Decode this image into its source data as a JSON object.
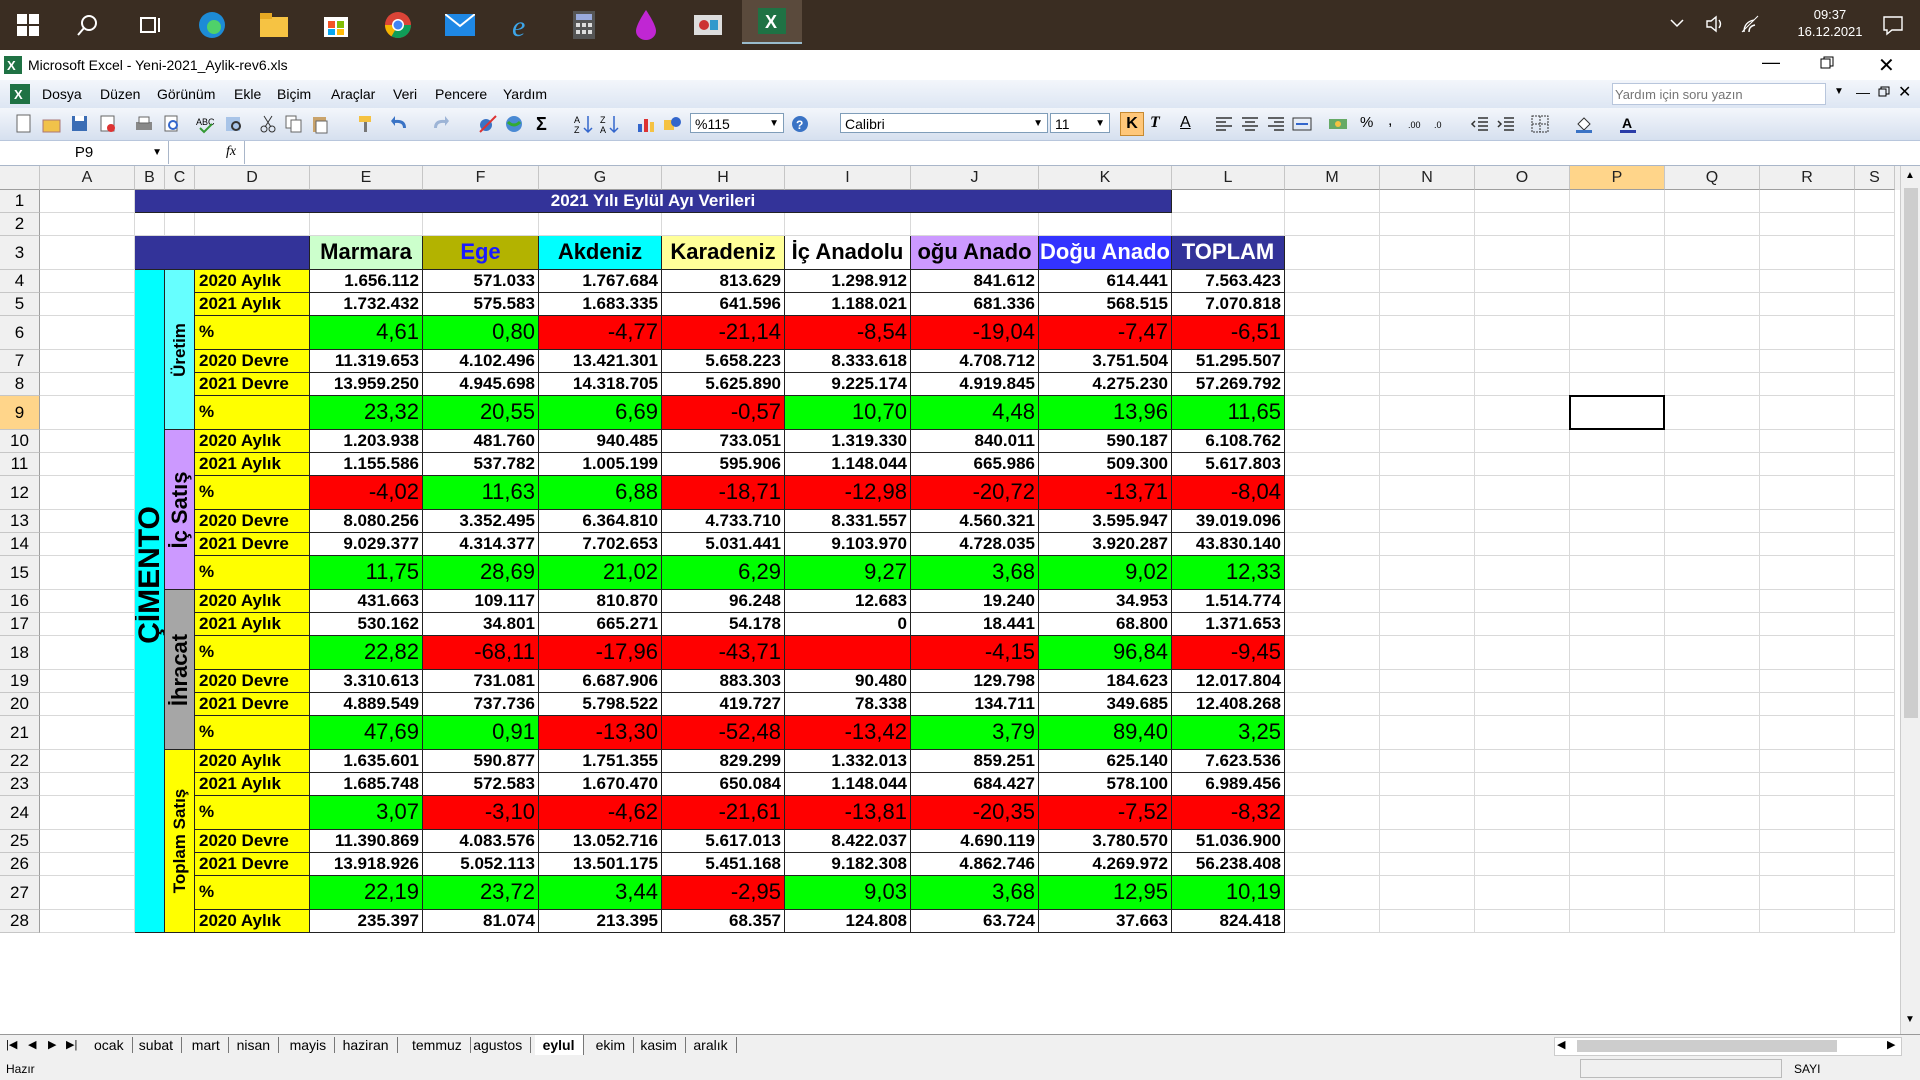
{
  "taskbar": {
    "time": "09:37",
    "date": "16.12.2021"
  },
  "window": {
    "title": "Microsoft Excel - Yeni-2021_Aylik-rev6.xls"
  },
  "menu": {
    "items": [
      "Dosya",
      "Düzen",
      "Görünüm",
      "Ekle",
      "Biçim",
      "Araçlar",
      "Veri",
      "Pencere",
      "Yardım"
    ],
    "help_placeholder": "Yardım için soru yazın"
  },
  "toolbar": {
    "zoom": "%115",
    "font": "Calibri",
    "size": "11"
  },
  "formula": {
    "name_box": "P9",
    "fx": "fx"
  },
  "columns": [
    "A",
    "B",
    "C",
    "D",
    "E",
    "F",
    "G",
    "H",
    "I",
    "J",
    "K",
    "L",
    "M",
    "N",
    "O",
    "P",
    "Q",
    "R",
    "S"
  ],
  "rows": [
    "1",
    "2",
    "3",
    "4",
    "5",
    "6",
    "7",
    "8",
    "9",
    "10",
    "11",
    "12",
    "13",
    "14",
    "15",
    "16",
    "17",
    "18",
    "19",
    "20",
    "21",
    "22",
    "23",
    "24",
    "25",
    "26",
    "27",
    "28"
  ],
  "sheet": {
    "title": "2021 Yılı Eylül Ayı Verileri",
    "headers": [
      "Marmara",
      "Ege",
      "Akdeniz",
      "Karadeniz",
      "İç Anadolu",
      "oğu Anado",
      "Doğu Anado",
      "TOPLAM"
    ],
    "header_colors": [
      "#ccffcc",
      "#b3b300",
      "#00ffff",
      "#ffff99",
      "#ffffff",
      "#cc99ff",
      "#3333ff",
      "#333399"
    ],
    "header_text_colors": [
      "#000000",
      "#1a1aff",
      "#000000",
      "#000000",
      "#000000",
      "#000000",
      "#ffffff",
      "#ffffff"
    ],
    "big_label": "ÇİMENTO",
    "groups": [
      {
        "label": "Üretim",
        "color": "#66ffff"
      },
      {
        "label": "İç Satış",
        "color": "#cc99ff"
      },
      {
        "label": "İhracat",
        "color": "#a6a6a6"
      },
      {
        "label": "Toplam Satış",
        "color": "#ffff00"
      }
    ],
    "data_rows": [
      {
        "label": "2020 Aylık",
        "pct": false,
        "values": [
          "1.656.112",
          "571.033",
          "1.767.684",
          "813.629",
          "1.298.912",
          "841.612",
          "614.441",
          "7.563.423"
        ]
      },
      {
        "label": "2021 Aylık",
        "pct": false,
        "values": [
          "1.732.432",
          "575.583",
          "1.683.335",
          "641.596",
          "1.188.021",
          "681.336",
          "568.515",
          "7.070.818"
        ]
      },
      {
        "label": "%",
        "pct": true,
        "values": [
          "4,61",
          "0,80",
          "-4,77",
          "-21,14",
          "-8,54",
          "-19,04",
          "-7,47",
          "-6,51"
        ]
      },
      {
        "label": "2020 Devre",
        "pct": false,
        "values": [
          "11.319.653",
          "4.102.496",
          "13.421.301",
          "5.658.223",
          "8.333.618",
          "4.708.712",
          "3.751.504",
          "51.295.507"
        ]
      },
      {
        "label": "2021 Devre",
        "pct": false,
        "values": [
          "13.959.250",
          "4.945.698",
          "14.318.705",
          "5.625.890",
          "9.225.174",
          "4.919.845",
          "4.275.230",
          "57.269.792"
        ]
      },
      {
        "label": "%",
        "pct": true,
        "values": [
          "23,32",
          "20,55",
          "6,69",
          "-0,57",
          "10,70",
          "4,48",
          "13,96",
          "11,65"
        ]
      },
      {
        "label": "2020 Aylık",
        "pct": false,
        "values": [
          "1.203.938",
          "481.760",
          "940.485",
          "733.051",
          "1.319.330",
          "840.011",
          "590.187",
          "6.108.762"
        ]
      },
      {
        "label": "2021 Aylık",
        "pct": false,
        "values": [
          "1.155.586",
          "537.782",
          "1.005.199",
          "595.906",
          "1.148.044",
          "665.986",
          "509.300",
          "5.617.803"
        ]
      },
      {
        "label": "%",
        "pct": true,
        "values": [
          "-4,02",
          "11,63",
          "6,88",
          "-18,71",
          "-12,98",
          "-20,72",
          "-13,71",
          "-8,04"
        ]
      },
      {
        "label": "2020 Devre",
        "pct": false,
        "values": [
          "8.080.256",
          "3.352.495",
          "6.364.810",
          "4.733.710",
          "8.331.557",
          "4.560.321",
          "3.595.947",
          "39.019.096"
        ]
      },
      {
        "label": "2021 Devre",
        "pct": false,
        "values": [
          "9.029.377",
          "4.314.377",
          "7.702.653",
          "5.031.441",
          "9.103.970",
          "4.728.035",
          "3.920.287",
          "43.830.140"
        ]
      },
      {
        "label": "%",
        "pct": true,
        "values": [
          "11,75",
          "28,69",
          "21,02",
          "6,29",
          "9,27",
          "3,68",
          "9,02",
          "12,33"
        ]
      },
      {
        "label": "2020 Aylık",
        "pct": false,
        "values": [
          "431.663",
          "109.117",
          "810.870",
          "96.248",
          "12.683",
          "19.240",
          "34.953",
          "1.514.774"
        ]
      },
      {
        "label": "2021 Aylık",
        "pct": false,
        "values": [
          "530.162",
          "34.801",
          "665.271",
          "54.178",
          "0",
          "18.441",
          "68.800",
          "1.371.653"
        ]
      },
      {
        "label": "%",
        "pct": true,
        "values": [
          "22,82",
          "-68,11",
          "-17,96",
          "-43,71",
          "",
          "-4,15",
          "96,84",
          "-9,45"
        ],
        "colors_override": [
          null,
          null,
          null,
          null,
          "#ff0000",
          null,
          null,
          null
        ]
      },
      {
        "label": "2020 Devre",
        "pct": false,
        "values": [
          "3.310.613",
          "731.081",
          "6.687.906",
          "883.303",
          "90.480",
          "129.798",
          "184.623",
          "12.017.804"
        ]
      },
      {
        "label": "2021 Devre",
        "pct": false,
        "values": [
          "4.889.549",
          "737.736",
          "5.798.522",
          "419.727",
          "78.338",
          "134.711",
          "349.685",
          "12.408.268"
        ]
      },
      {
        "label": "%",
        "pct": true,
        "values": [
          "47,69",
          "0,91",
          "-13,30",
          "-52,48",
          "-13,42",
          "3,79",
          "89,40",
          "3,25"
        ]
      },
      {
        "label": "2020 Aylık",
        "pct": false,
        "values": [
          "1.635.601",
          "590.877",
          "1.751.355",
          "829.299",
          "1.332.013",
          "859.251",
          "625.140",
          "7.623.536"
        ]
      },
      {
        "label": "2021 Aylık",
        "pct": false,
        "values": [
          "1.685.748",
          "572.583",
          "1.670.470",
          "650.084",
          "1.148.044",
          "684.427",
          "578.100",
          "6.989.456"
        ]
      },
      {
        "label": "%",
        "pct": true,
        "values": [
          "3,07",
          "-3,10",
          "-4,62",
          "-21,61",
          "-13,81",
          "-20,35",
          "-7,52",
          "-8,32"
        ]
      },
      {
        "label": "2020 Devre",
        "pct": false,
        "values": [
          "11.390.869",
          "4.083.576",
          "13.052.716",
          "5.617.013",
          "8.422.037",
          "4.690.119",
          "3.780.570",
          "51.036.900"
        ]
      },
      {
        "label": "2021 Devre",
        "pct": false,
        "values": [
          "13.918.926",
          "5.052.113",
          "13.501.175",
          "5.451.168",
          "9.182.308",
          "4.862.746",
          "4.269.972",
          "56.238.408"
        ]
      },
      {
        "label": "%",
        "pct": true,
        "values": [
          "22,19",
          "23,72",
          "3,44",
          "-2,95",
          "9,03",
          "3,68",
          "12,95",
          "10,19"
        ]
      },
      {
        "label": "2020 Aylık",
        "pct": false,
        "values": [
          "235.397",
          "81.074",
          "213.395",
          "68.357",
          "124.808",
          "63.724",
          "37.663",
          "824.418"
        ]
      }
    ]
  },
  "sheet_tabs": [
    "ocak",
    "subat",
    "mart",
    "nisan",
    "mayis",
    "haziran",
    "temmuz",
    "agustos",
    "eylul",
    "ekim",
    "kasim",
    "aralık"
  ],
  "active_tab": "eylul",
  "status": {
    "left": "Hazır",
    "right": "SAYI"
  },
  "colors": {
    "positive": "#00ff00",
    "negative": "#ff0000",
    "title_bar": "#333399"
  }
}
